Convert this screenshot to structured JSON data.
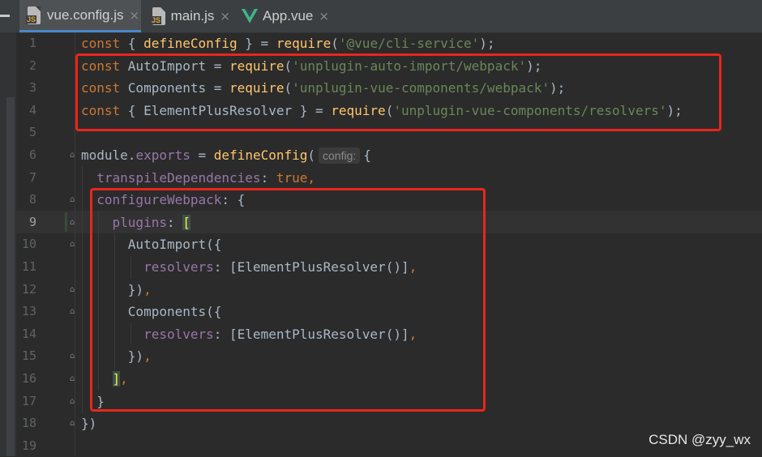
{
  "tabs": [
    {
      "label": "vue.config.js",
      "icon": "js-file-icon",
      "active": true
    },
    {
      "label": "main.js",
      "icon": "js-file-icon",
      "active": false
    },
    {
      "label": "App.vue",
      "icon": "vue-logo-icon",
      "active": false
    }
  ],
  "js_badge": "JS",
  "close_glyph": "×",
  "editor": {
    "current_line": 9,
    "lines": [
      {
        "n": "1",
        "tokens": [
          {
            "t": "const ",
            "c": "kw"
          },
          {
            "t": "{ "
          },
          {
            "t": "defineConfig",
            "c": "fn"
          },
          {
            "t": " } = "
          },
          {
            "t": "require",
            "c": "fn"
          },
          {
            "t": "("
          },
          {
            "t": "'@vue/cli-service'",
            "c": "str"
          },
          {
            "t": ");"
          }
        ]
      },
      {
        "n": "2",
        "tokens": [
          {
            "t": "const ",
            "c": "kw"
          },
          {
            "t": "AutoImport = "
          },
          {
            "t": "require",
            "c": "fn"
          },
          {
            "t": "("
          },
          {
            "t": "'unplugin-auto-import/webpack'",
            "c": "str"
          },
          {
            "t": ");"
          }
        ]
      },
      {
        "n": "3",
        "tokens": [
          {
            "t": "const ",
            "c": "kw"
          },
          {
            "t": "Components = "
          },
          {
            "t": "require",
            "c": "fn"
          },
          {
            "t": "("
          },
          {
            "t": "'unplugin-vue-components/webpack'",
            "c": "str"
          },
          {
            "t": ");"
          }
        ]
      },
      {
        "n": "4",
        "tokens": [
          {
            "t": "const ",
            "c": "kw"
          },
          {
            "t": "{ ElementPlusResolver } = "
          },
          {
            "t": "require",
            "c": "fn"
          },
          {
            "t": "("
          },
          {
            "t": "'unplugin-vue-components/resolvers'",
            "c": "str"
          },
          {
            "t": ");"
          }
        ]
      },
      {
        "n": "5",
        "tokens": []
      },
      {
        "n": "6",
        "tokens": [
          {
            "t": "module"
          },
          {
            "t": "."
          },
          {
            "t": "exports",
            "c": "prop"
          },
          {
            "t": " = "
          },
          {
            "t": "defineConfig",
            "c": "fn"
          },
          {
            "t": "("
          },
          {
            "hint": "config:"
          },
          {
            "t": "{"
          }
        ]
      },
      {
        "n": "7",
        "tokens": [
          {
            "t": "  "
          },
          {
            "t": "transpileDependencies",
            "c": "prop"
          },
          {
            "t": ": "
          },
          {
            "t": "true",
            "c": "kw"
          },
          {
            "t": ",",
            "c": "kw"
          }
        ]
      },
      {
        "n": "8",
        "tokens": [
          {
            "t": "  "
          },
          {
            "t": "configureWebpack",
            "c": "prop"
          },
          {
            "t": ": {"
          }
        ]
      },
      {
        "n": "9",
        "tokens": [
          {
            "t": "    "
          },
          {
            "t": "plugins",
            "c": "prop"
          },
          {
            "t": ": "
          },
          {
            "t": "[",
            "c": "bracket"
          }
        ]
      },
      {
        "n": "10",
        "tokens": [
          {
            "t": "      AutoImport({"
          }
        ]
      },
      {
        "n": "11",
        "tokens": [
          {
            "t": "        "
          },
          {
            "t": "resolvers",
            "c": "prop"
          },
          {
            "t": ": [ElementPlusResolver()]"
          },
          {
            "t": ",",
            "c": "kw"
          }
        ]
      },
      {
        "n": "12",
        "tokens": [
          {
            "t": "      })"
          },
          {
            "t": ",",
            "c": "kw"
          }
        ]
      },
      {
        "n": "13",
        "tokens": [
          {
            "t": "      Components({"
          }
        ]
      },
      {
        "n": "14",
        "tokens": [
          {
            "t": "        "
          },
          {
            "t": "resolvers",
            "c": "prop"
          },
          {
            "t": ": [ElementPlusResolver()]"
          },
          {
            "t": ",",
            "c": "kw"
          }
        ]
      },
      {
        "n": "15",
        "tokens": [
          {
            "t": "      })"
          },
          {
            "t": ",",
            "c": "kw"
          }
        ]
      },
      {
        "n": "16",
        "tokens": [
          {
            "t": "    "
          },
          {
            "t": "]",
            "c": "bracket"
          },
          {
            "t": ",",
            "c": "kw"
          }
        ]
      },
      {
        "n": "17",
        "tokens": [
          {
            "t": "  }"
          }
        ]
      },
      {
        "n": "18",
        "tokens": [
          {
            "t": "})"
          }
        ]
      },
      {
        "n": "19",
        "tokens": []
      }
    ],
    "fold_lines": [
      "6",
      "8",
      "9",
      "10",
      "12",
      "13",
      "15",
      "16",
      "17",
      "18"
    ]
  },
  "colors": {
    "keyword": "#cc7832",
    "function": "#ffc66d",
    "string": "#6a8759",
    "property": "#9876aa",
    "text": "#a9b7c6",
    "annotation": "#e8261c"
  },
  "watermark": "CSDN @zyy_wx"
}
